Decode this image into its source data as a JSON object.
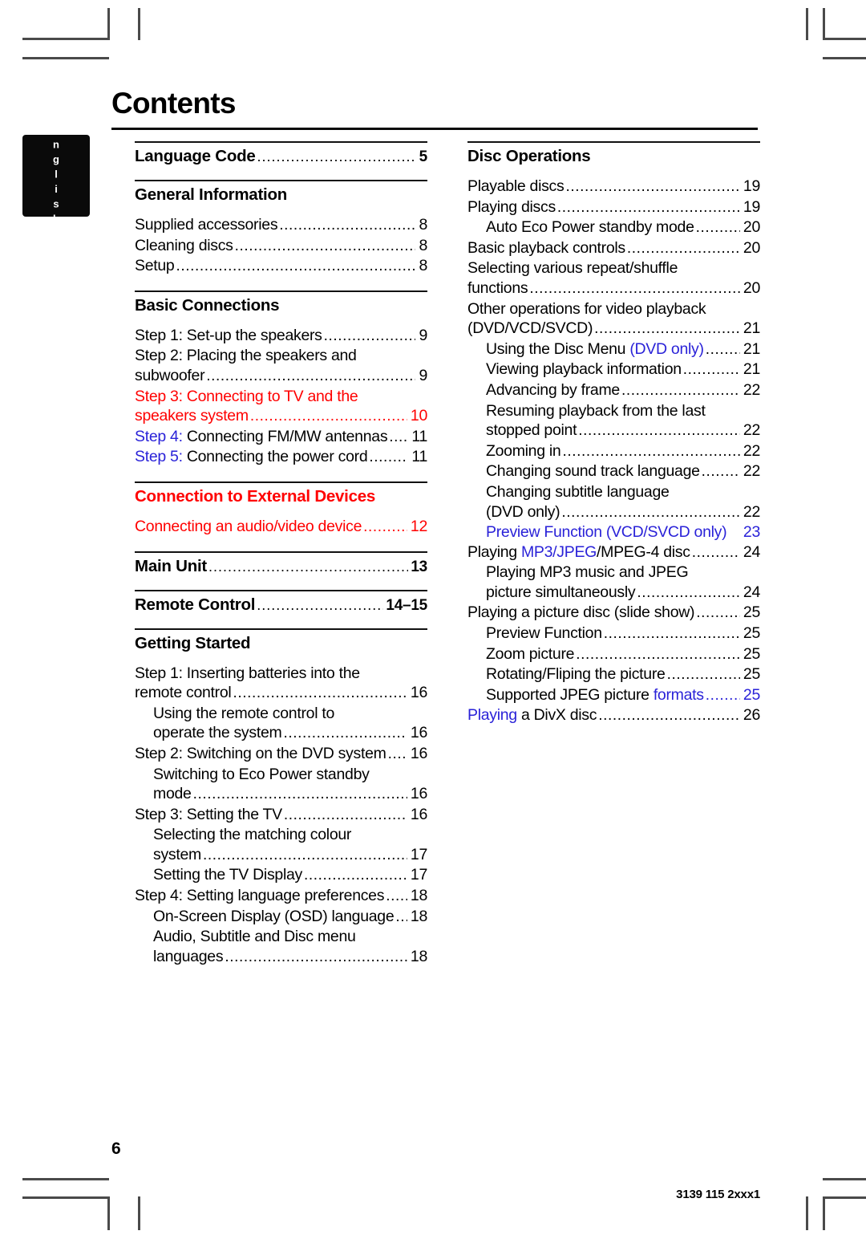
{
  "page": {
    "title": "Contents",
    "language_tab": "English",
    "page_number": "6",
    "doc_code": "3139 115 2xxx1"
  },
  "colors": {
    "red": "#ff0000",
    "blue": "#2a22d8",
    "text": "#000000"
  },
  "left_column": [
    {
      "type": "section",
      "heading": {
        "text": "Language Code",
        "page": "5",
        "leader": true,
        "color": "text"
      },
      "entries": []
    },
    {
      "type": "section",
      "heading": {
        "text": "General Information",
        "page": "",
        "leader": false,
        "color": "text"
      },
      "entries": [
        {
          "text": "Supplied accessories",
          "page": "8",
          "indent": 0,
          "color": "text",
          "leader": true
        },
        {
          "text": "Cleaning discs",
          "page": "8",
          "indent": 0,
          "color": "text",
          "leader": true
        },
        {
          "text": "Setup",
          "page": "8",
          "indent": 0,
          "color": "text",
          "leader": true
        }
      ]
    },
    {
      "type": "section",
      "heading": {
        "text": "Basic Connections",
        "page": "",
        "leader": false,
        "color": "text"
      },
      "entries": [
        {
          "text": "Step 1: Set-up the speakers",
          "page": "9",
          "indent": 0,
          "color": "text",
          "leader": true
        },
        {
          "text": "Step 2: Placing the speakers and",
          "page": "",
          "indent": 0,
          "color": "text",
          "leader": false
        },
        {
          "text": "subwoofer",
          "page": "9",
          "indent": 0,
          "color": "text",
          "leader": true
        },
        {
          "text": "Step 3: Connecting to TV and the",
          "page": "",
          "indent": 0,
          "color": "red",
          "leader": false
        },
        {
          "text": "speakers system",
          "page": "10",
          "indent": 0,
          "color": "red",
          "leader": true
        },
        {
          "prefix": "Step 4:",
          "prefix_color": "blue",
          "text": " Connecting FM/MW antennas",
          "page": "11",
          "indent": 0,
          "color": "text",
          "leader": true,
          "short_leader": true
        },
        {
          "prefix": "Step 5:",
          "prefix_color": "blue",
          "text": " Connecting the power cord",
          "page": "11",
          "indent": 0,
          "color": "text",
          "leader": true,
          "short_leader": true
        }
      ]
    },
    {
      "type": "section",
      "heading": {
        "text": "Connection to External Devices",
        "page": "",
        "leader": false,
        "color": "red"
      },
      "entries": [
        {
          "text": "Connecting an audio/video device",
          "page": "12",
          "indent": 0,
          "color": "red",
          "leader": true,
          "short_leader": true
        }
      ]
    },
    {
      "type": "section",
      "heading": {
        "text": "Main Unit",
        "page": "13",
        "leader": true,
        "color": "text"
      },
      "entries": []
    },
    {
      "type": "section",
      "heading": {
        "text": "Remote Control",
        "page": "14–15",
        "leader": true,
        "color": "text"
      },
      "entries": []
    },
    {
      "type": "section",
      "heading": {
        "text": "Getting Started",
        "page": "",
        "leader": false,
        "color": "text"
      },
      "entries": [
        {
          "text": "Step 1: Inserting batteries into the",
          "page": "",
          "indent": 0,
          "color": "text",
          "leader": false
        },
        {
          "text": "remote control",
          "page": "16",
          "indent": 0,
          "color": "text",
          "leader": true
        },
        {
          "text": "Using the remote control to",
          "page": "",
          "indent": 1,
          "color": "text",
          "leader": false
        },
        {
          "text": "operate the system",
          "page": "16",
          "indent": 1,
          "color": "text",
          "leader": true
        },
        {
          "text": "Step 2: Switching on the DVD system",
          "page": "16",
          "indent": 0,
          "color": "text",
          "leader": true,
          "short_leader": true
        },
        {
          "text": "Switching to Eco Power standby",
          "page": "",
          "indent": 1,
          "color": "text",
          "leader": false
        },
        {
          "text": "mode",
          "page": "16",
          "indent": 1,
          "color": "text",
          "leader": true
        },
        {
          "text": "Step 3: Setting the TV",
          "page": "16",
          "indent": 0,
          "color": "text",
          "leader": true
        },
        {
          "text": "Selecting the matching colour",
          "page": "",
          "indent": 1,
          "color": "text",
          "leader": false
        },
        {
          "text": "system",
          "page": "17",
          "indent": 1,
          "color": "text",
          "leader": true
        },
        {
          "text": "Setting the TV Display",
          "page": "17",
          "indent": 1,
          "color": "text",
          "leader": true
        },
        {
          "text": "Step 4: Setting language preferences",
          "page": "18",
          "indent": 0,
          "color": "text",
          "leader": true,
          "short_leader": true
        },
        {
          "text": "On-Screen Display (OSD) language",
          "page": "18",
          "indent": 1,
          "color": "text",
          "leader": true,
          "short_leader": true
        },
        {
          "text": "Audio, Subtitle and Disc menu",
          "page": "",
          "indent": 1,
          "color": "text",
          "leader": false
        },
        {
          "text": "languages",
          "page": "18",
          "indent": 1,
          "color": "text",
          "leader": true
        }
      ]
    }
  ],
  "right_column": [
    {
      "type": "section",
      "heading": {
        "text": "Disc Operations",
        "page": "",
        "leader": false,
        "color": "text"
      },
      "entries": [
        {
          "text": "Playable discs",
          "page": "19",
          "indent": 0,
          "color": "text",
          "leader": true
        },
        {
          "text": "Playing discs",
          "page": "19",
          "indent": 0,
          "color": "text",
          "leader": true
        },
        {
          "text": "Auto Eco Power standby mode",
          "page": "20",
          "indent": 1,
          "color": "text",
          "leader": true,
          "short_leader": true
        },
        {
          "text": "Basic playback controls",
          "page": "20",
          "indent": 0,
          "color": "text",
          "leader": true
        },
        {
          "text": "Selecting various repeat/shuffle",
          "page": "",
          "indent": 0,
          "color": "text",
          "leader": false
        },
        {
          "text": "functions",
          "page": "20",
          "indent": 0,
          "color": "text",
          "leader": true
        },
        {
          "text": "Other operations for video playback",
          "page": "",
          "indent": 0,
          "color": "text",
          "leader": false
        },
        {
          "text": "(DVD/VCD/SVCD)",
          "page": "21",
          "indent": 0,
          "color": "text",
          "leader": true
        },
        {
          "text": "Using the Disc Menu ",
          "suffix": "(DVD only)",
          "suffix_color": "blue",
          "page": "21",
          "indent": 1,
          "color": "text",
          "leader": true,
          "short_leader": true
        },
        {
          "text": "Viewing playback information",
          "page": "21",
          "indent": 1,
          "color": "text",
          "leader": true,
          "short_leader": true
        },
        {
          "text": "Advancing by frame",
          "page": "22",
          "indent": 1,
          "color": "text",
          "leader": true
        },
        {
          "text": "Resuming playback from the last",
          "page": "",
          "indent": 1,
          "color": "text",
          "leader": false
        },
        {
          "text": "stopped point",
          "page": "22",
          "indent": 1,
          "color": "text",
          "leader": true
        },
        {
          "text": "Zooming in",
          "page": "22",
          "indent": 1,
          "color": "text",
          "leader": true
        },
        {
          "text": "Changing sound track language",
          "page": "22",
          "indent": 1,
          "color": "text",
          "leader": true,
          "short_leader": true
        },
        {
          "text": "Changing subtitle language",
          "page": "",
          "indent": 1,
          "color": "text",
          "leader": false
        },
        {
          "text": "(DVD only)",
          "page": "22",
          "indent": 1,
          "color": "text",
          "leader": true
        },
        {
          "text": "Preview Function (VCD/SVCD only)",
          "page": "23",
          "indent": 1,
          "color": "blue",
          "leader": false,
          "no_gap": true
        },
        {
          "prefix": "Playing ",
          "prefix_color": "text",
          "mid": "MP3/JPEG",
          "mid_color": "blue",
          "text": "/MPEG-4 disc",
          "page": "24",
          "indent": 0,
          "color": "text",
          "leader": true,
          "short_leader": true
        },
        {
          "text": "Playing MP3 music and JPEG",
          "page": "",
          "indent": 1,
          "color": "text",
          "leader": false
        },
        {
          "text": "picture simultaneously",
          "page": "24",
          "indent": 1,
          "color": "text",
          "leader": true,
          "short_leader": true
        },
        {
          "text": "Playing a picture disc (slide show)",
          "page": "25",
          "indent": 0,
          "color": "text",
          "leader": true,
          "short_leader": true
        },
        {
          "text": "Preview Function",
          "page": "25",
          "indent": 1,
          "color": "text",
          "leader": true
        },
        {
          "text": "Zoom picture",
          "page": "25",
          "indent": 1,
          "color": "text",
          "leader": true
        },
        {
          "text": "Rotating/Fliping the picture",
          "page": "25",
          "indent": 1,
          "color": "text",
          "leader": true,
          "short_leader": true
        },
        {
          "text": "Supported JPEG picture ",
          "suffix": "formats",
          "suffix_color": "blue",
          "page": "25",
          "page_color": "blue",
          "indent": 1,
          "color": "text",
          "leader": true,
          "leader_color": "blue",
          "short_leader": true
        },
        {
          "prefix": "Playing",
          "prefix_color": "blue",
          "text": " a DivX disc",
          "page": "26",
          "indent": 0,
          "color": "text",
          "leader": true
        }
      ]
    }
  ]
}
